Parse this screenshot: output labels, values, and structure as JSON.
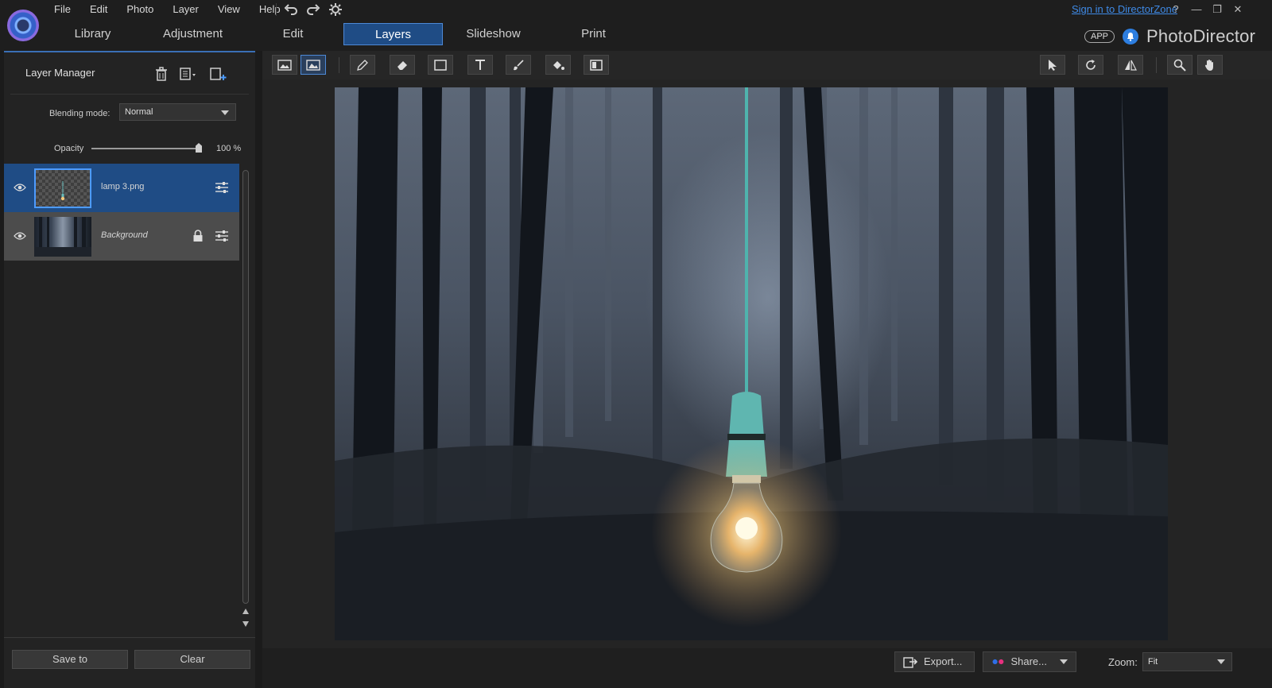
{
  "app": {
    "name": "PhotoDirector",
    "signin_link": "Sign in to DirectorZone",
    "app_badge": "APP",
    "accent_color": "#1f4c85"
  },
  "menubar": {
    "items": [
      "File",
      "Edit",
      "Photo",
      "Layer",
      "View",
      "Help"
    ]
  },
  "modes": {
    "items": [
      "Library",
      "Adjustment",
      "Edit",
      "Layers",
      "Slideshow",
      "Print"
    ],
    "active": "Layers"
  },
  "window_controls": [
    "?",
    "—",
    "❐",
    "✕"
  ],
  "layer_manager": {
    "title": "Layer Manager",
    "blending_label": "Blending mode:",
    "blending_value": "Normal",
    "opacity_label": "Opacity",
    "opacity_value": "100 %",
    "opacity_fraction": 1.0,
    "layers": [
      {
        "name": "lamp 3.png",
        "selected": true,
        "locked": false
      },
      {
        "name": "Background",
        "selected": false,
        "locked": true
      }
    ],
    "save_button": "Save to",
    "clear_button": "Clear"
  },
  "toolbar": {
    "tools": [
      "layer-view-icon",
      "image-layer-icon",
      "pencil-icon",
      "eraser-icon",
      "rectangle-icon",
      "text-icon",
      "brush-icon",
      "fill-bucket-icon",
      "gradient-icon",
      "select-arrow-icon",
      "rotate-icon",
      "flip-icon",
      "zoom-icon",
      "hand-icon"
    ]
  },
  "bottombar": {
    "export_label": "Export...",
    "share_label": "Share...",
    "zoom_label": "Zoom:",
    "zoom_value": "Fit"
  }
}
